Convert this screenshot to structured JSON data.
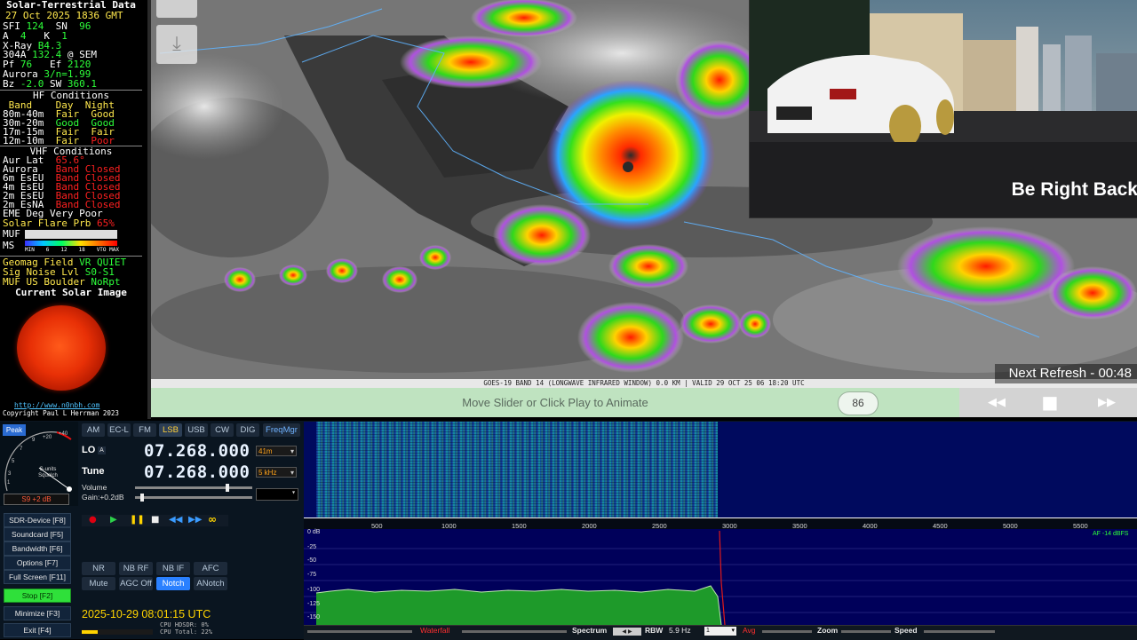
{
  "solar": {
    "title": "Solar-Terrestrial Data",
    "datetime": "27 Oct 2025 1836 GMT",
    "sfi_label": "SFI",
    "sfi": "124",
    "sn_label": "SN",
    "sn": "96",
    "a_label": "A",
    "a": "4",
    "k_label": "K",
    "k": "1",
    "xray_label": "X-Ray",
    "xray": "B4.3",
    "h304_label": "304A",
    "h304": "132.4",
    "h304_suffix": "@ SEM",
    "pf_label": "Pf",
    "pf": "76",
    "ef_label": "Ef",
    "ef": "2120",
    "aurora_label": "Aurora",
    "aurora": "3/n=1.99",
    "bz_label": "Bz",
    "bz": "-2.0",
    "sw_label": "SW",
    "sw": "360.1",
    "hf_title": "HF Conditions",
    "hf_headers": [
      "Band",
      "Day",
      "Night"
    ],
    "hf_rows": [
      {
        "band": "80m-40m",
        "day": "Fair",
        "night": "Good"
      },
      {
        "band": "30m-20m",
        "day": "Good",
        "night": "Good"
      },
      {
        "band": "17m-15m",
        "day": "Fair",
        "night": "Fair"
      },
      {
        "band": "12m-10m",
        "day": "Fair",
        "night": "Poor"
      }
    ],
    "vhf_title": "VHF Conditions",
    "vhf_rows": [
      {
        "label": "Aur Lat",
        "value": "65.6°"
      },
      {
        "label": "Aurora",
        "value": "Band Closed"
      },
      {
        "label": "6m EsEU",
        "value": "Band Closed"
      },
      {
        "label": "4m EsEU",
        "value": "Band Closed"
      },
      {
        "label": "2m EsEU",
        "value": "Band Closed"
      },
      {
        "label": "2m EsNA",
        "value": "Band Closed"
      }
    ],
    "eme_label": "EME Deg",
    "eme": "Very Poor",
    "flare_label": "Solar Flare Prb",
    "flare": "65%",
    "muf_label": "MUF",
    "ms_label": "MS",
    "muf_scale": [
      "MIN",
      "6",
      "12",
      "18",
      "VTO MAX"
    ],
    "geomag_label": "Geomag Field",
    "geomag": "VR QUIET",
    "noise_label": "Sig Noise Lvl",
    "noise": "S0-S1",
    "mufus_label": "MUF US Boulder",
    "mufus": "NoRpt",
    "image_title": "Current Solar Image",
    "url": "http://www.n0nbh.com",
    "copyright": "Copyright Paul L Herrman 2023"
  },
  "map": {
    "caption": "GOES-19 BAND 14 (LONGWAVE INFRARED WINDOW) 0.0 KM | VALID 29 OCT 25 06 18:20 UTC",
    "next_refresh": "Next Refresh - 00:48"
  },
  "camera": {
    "overlay": "Be Right Back"
  },
  "anim": {
    "hint": "Move Slider or Click Play to Animate",
    "frame": "86",
    "rewind_icon": "◀◀",
    "stop_icon": "■",
    "forward_icon": "▶▶"
  },
  "sdr": {
    "peak": "Peak",
    "smeter_caption": "S-units\nSquelch",
    "smeter_value": "S9 +2 dB",
    "modes": [
      "AM",
      "EC-L",
      "FM",
      "LSB",
      "USB",
      "CW",
      "DIG",
      "FreqMgr"
    ],
    "active_mode": "LSB",
    "lo_label": "LO",
    "lo_a": "A",
    "lo_freq": "07.268.000",
    "band_select": "41m",
    "tune_label": "Tune",
    "tune_freq": "07.268.000",
    "bw_select": "5 kHz",
    "volume_label": "Volume",
    "gain_label": "Gain:+0.2dB",
    "function_buttons": [
      {
        "label": "SDR-Device [F8]"
      },
      {
        "label": "Soundcard [F5]"
      },
      {
        "label": "Bandwidth [F6]"
      },
      {
        "label": "Options [F7]"
      },
      {
        "label": "Full Screen [F11]"
      },
      {
        "label": "Stop [F2]"
      },
      {
        "label": "Minimize [F3]"
      },
      {
        "label": "Exit [F4]"
      }
    ],
    "dsp_row1": [
      "NR",
      "NB RF",
      "NB IF",
      "AFC"
    ],
    "dsp_row2": [
      "Mute",
      "AGC Off",
      "Notch",
      "ANotch"
    ],
    "datetime": "2025-10-29 08:01:15 UTC",
    "cpu_hdsdr": "CPU HDSDR: 0%",
    "cpu_total": "CPU Total: 22%",
    "freq_ticks": [
      "500",
      "1000",
      "1500",
      "2000",
      "2500",
      "3000",
      "3500",
      "4000",
      "4500",
      "5000",
      "5500"
    ],
    "db_ticks": [
      "0 dB",
      "-25",
      "-50",
      "-75",
      "-100",
      "-125",
      "-150"
    ],
    "af_label": "AF -14 dBFS",
    "bottom": {
      "waterfall": "Waterfall",
      "spectrum": "Spectrum",
      "rbw_label": "RBW",
      "rbw": "5.9 Hz",
      "avg_select": "1",
      "avg": "Avg",
      "zoom": "Zoom",
      "speed": "Speed"
    }
  },
  "colors": {
    "accent_green": "#2dff3a",
    "accent_yellow": "#ffe84d",
    "accent_red": "#ff2020",
    "sdr_bg": "#0a1520",
    "spectrum_bg": "#00005a"
  }
}
